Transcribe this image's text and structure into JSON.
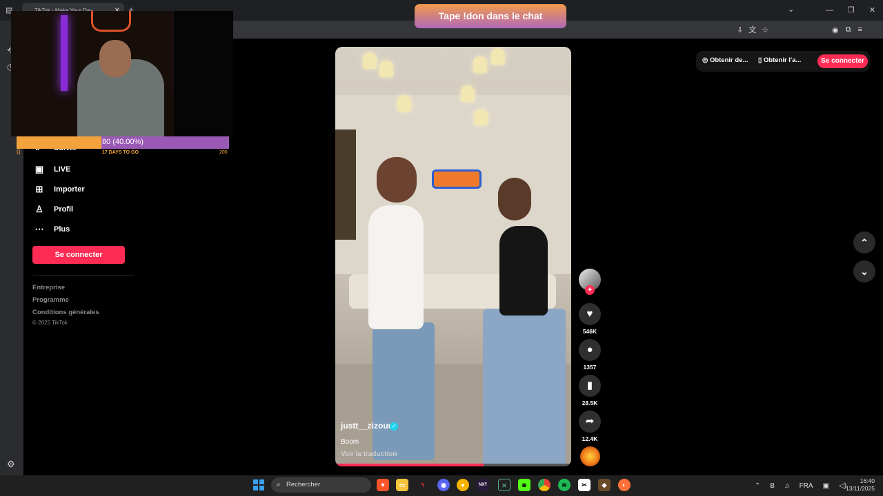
{
  "browser": {
    "tab_title": "TikTok - Make Your Day",
    "tab_close": "✕",
    "new_tab": "+",
    "window_controls": [
      "⌄",
      "—",
      "❐",
      "✕"
    ]
  },
  "stream_overlay": {
    "banner": "Tape !don dans le chat",
    "goal_current": "80 (40.00%)",
    "goal_min": "0",
    "goal_days": "17 DAYS TO GO",
    "goal_max": "200",
    "goal_progress": 0.4
  },
  "sidebar": {
    "items": [
      {
        "label": "Suivis",
        "icon": "following-icon",
        "glyph": "⇤"
      },
      {
        "label": "LIVE",
        "icon": "live-tv-icon",
        "glyph": "▣"
      },
      {
        "label": "Importer",
        "icon": "upload-plus-icon",
        "glyph": "⊞"
      },
      {
        "label": "Profil",
        "icon": "user-icon",
        "glyph": "♙"
      },
      {
        "label": "Plus",
        "icon": "more-dots-icon",
        "glyph": "⋯"
      }
    ],
    "login_button": "Se connecter",
    "footer": [
      "Entreprise",
      "Programme",
      "Conditions générales"
    ],
    "copyright": "© 2025 TikTok"
  },
  "top_right": {
    "get_coins": "Obtenir de...",
    "get_app": "Obtenir l'a...",
    "login_button": "Se connecter"
  },
  "video": {
    "author": "justt__zizouu",
    "caption": "Boom",
    "translate": "Voir la traduction",
    "progress": 0.63
  },
  "actions": {
    "likes": "546K",
    "comments": "1357",
    "saves": "28.5K",
    "shares": "12.4K"
  },
  "taskbar": {
    "search_placeholder": "Rechercher",
    "lang": "FRA",
    "time": "16:40",
    "date": "13/11/2025"
  }
}
